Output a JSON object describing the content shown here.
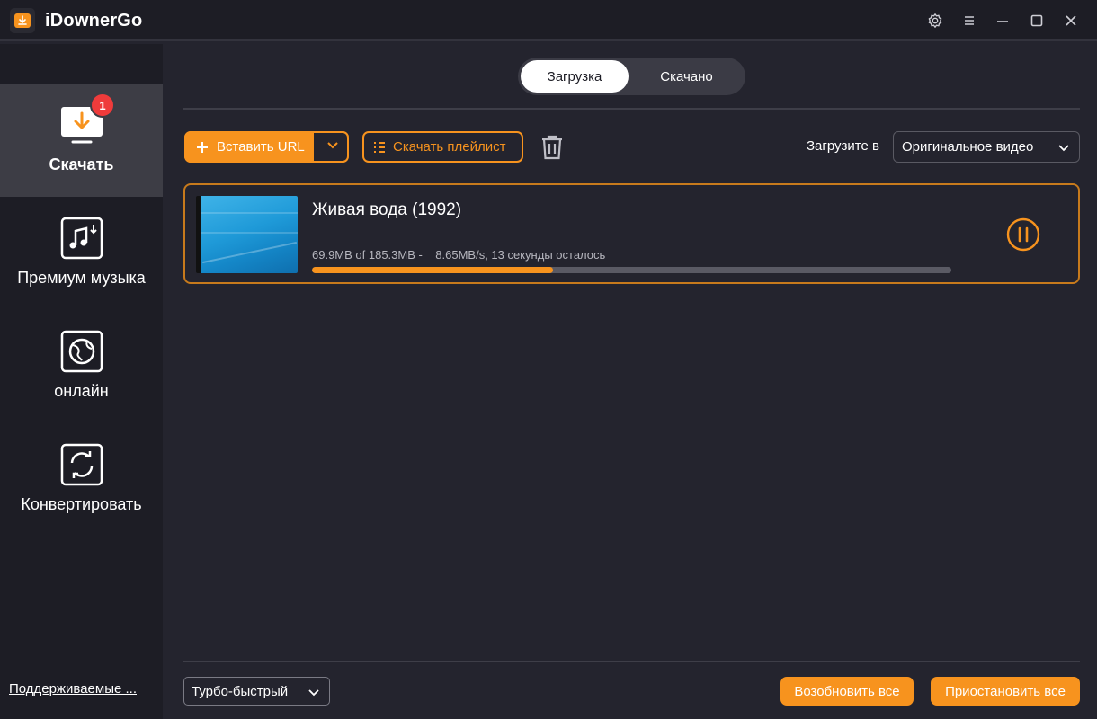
{
  "app": {
    "title": "iDownerGo",
    "icons": {
      "logo": "download-logo-icon",
      "settings": "gear-icon",
      "menu": "hamburger-icon",
      "minimize": "minimize-icon",
      "maximize": "maximize-icon",
      "close": "close-icon"
    }
  },
  "sidebar": {
    "items": [
      {
        "label": "Скачать",
        "icon": "download-monitor-icon",
        "badge": "1",
        "active": true
      },
      {
        "label": "Премиум музыка",
        "icon": "music-download-icon",
        "active": false
      },
      {
        "label": "онлайн",
        "icon": "globe-icon",
        "active": false
      },
      {
        "label": "Конвертировать",
        "icon": "convert-icon",
        "active": false
      }
    ],
    "supported_link": "Поддерживаемые ..."
  },
  "tabs": [
    {
      "label": "Загрузка",
      "active": true
    },
    {
      "label": "Скачано",
      "active": false
    }
  ],
  "toolbar": {
    "paste_url_label": "Вставить URL",
    "download_playlist_label": "Скачать плейлист",
    "download_to_label": "Загрузите в",
    "quality_value": "Оригинальное видео"
  },
  "download": {
    "title": "Живая вода (1992)",
    "stats": "69.9MB of 185.3MB -    8.65MB/s, 13 секунды осталось",
    "progress": 0.377
  },
  "footer": {
    "speed_value": "Турбо-быстрый",
    "resume_all_label": "Возобновить все",
    "pause_all_label": "Приостановить все"
  },
  "colors": {
    "accent": "#f7931e",
    "background": "#24242e",
    "sidebar": "#1d1d25",
    "badge": "#ef3b3b"
  }
}
